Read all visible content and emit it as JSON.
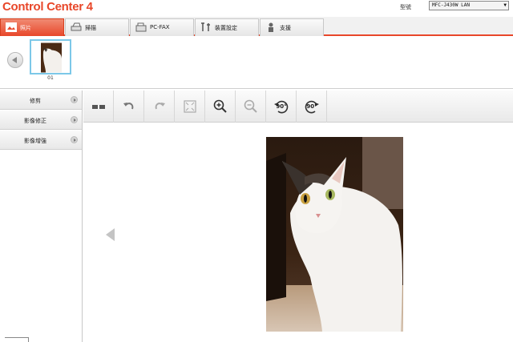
{
  "app": {
    "logo_text": "Control Center 4",
    "model_label": "型號",
    "model_value": "MFC-J430W LAN"
  },
  "tabs": [
    {
      "label": "照片",
      "icon": "photo-icon",
      "active": true
    },
    {
      "label": "掃描",
      "icon": "scanner-icon",
      "active": false
    },
    {
      "label": "PC-FAX",
      "icon": "fax-icon",
      "active": false
    },
    {
      "label": "裝置設定",
      "icon": "tools-icon",
      "active": false
    },
    {
      "label": "支援",
      "icon": "person-icon",
      "active": false
    }
  ],
  "thumbnails": [
    {
      "number": "01"
    }
  ],
  "side_menu": [
    {
      "label": "修剪"
    },
    {
      "label": "影像修正"
    },
    {
      "label": "影像增強"
    }
  ],
  "toolbar": {
    "rotate_left_label": "90°",
    "rotate_right_label": "90°"
  },
  "colors": {
    "accent": "#e8472a",
    "thumb_border": "#7cc8e8"
  }
}
